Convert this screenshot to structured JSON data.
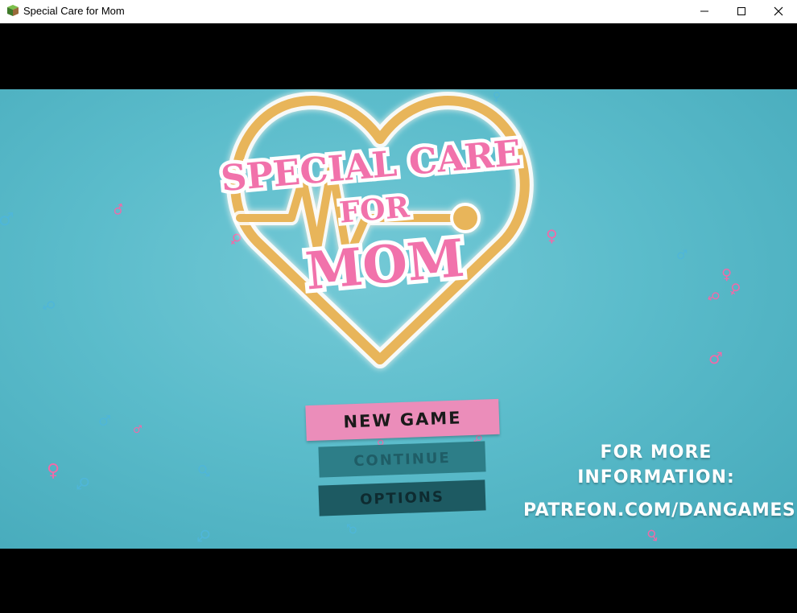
{
  "window": {
    "title": "Special Care for Mom",
    "icon": "game-cube-icon",
    "controls": [
      "minimize-icon",
      "maximize-icon",
      "close-icon"
    ]
  },
  "logo": {
    "line1": "SPECIAL CARE",
    "line2": "FOR",
    "line3": "MOM",
    "heart_color": "#e8b55a",
    "text_color": "#f172ab"
  },
  "menu": {
    "new_game": "NEW GAME",
    "continue": "CONTINUE",
    "options": "OPTIONS"
  },
  "info": {
    "line1": "FOR MORE",
    "line2": "INFORMATION:",
    "link": "PATREON.COM/DANGAMES"
  },
  "colors": {
    "background": "#5bbccb",
    "accent_pink": "#eb8dba",
    "button_dark": "#1d5a62"
  },
  "symbols": {
    "female": "♀",
    "male": "♂"
  }
}
